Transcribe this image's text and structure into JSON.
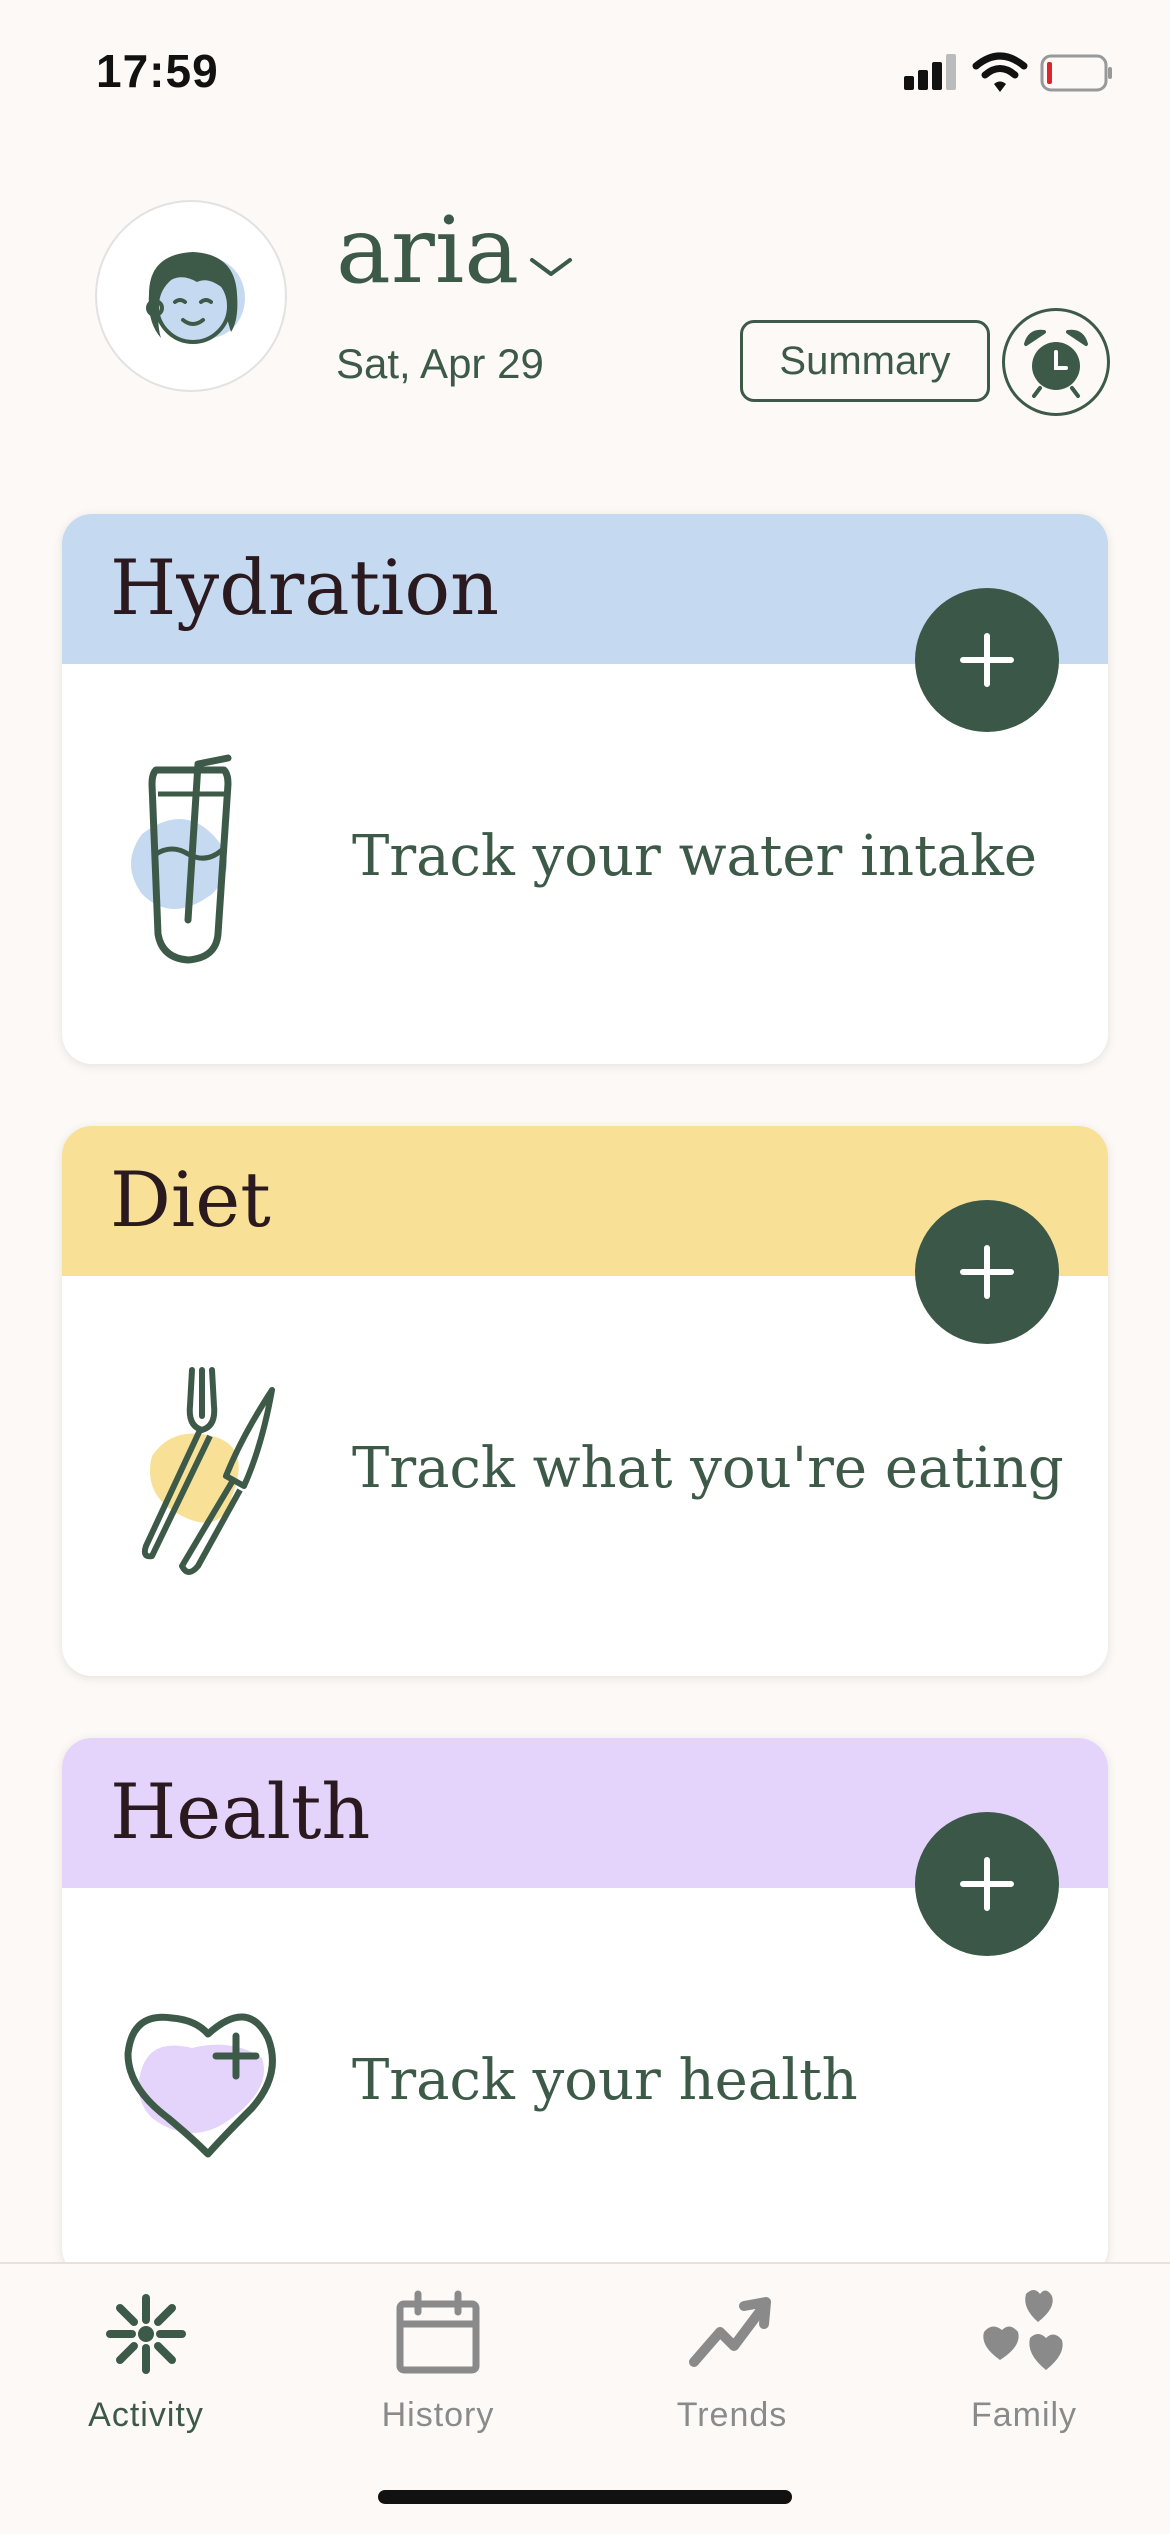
{
  "status_bar": {
    "time": "17:59",
    "icons": [
      "cellular-signal-icon",
      "wifi-icon",
      "battery-low-icon"
    ]
  },
  "header": {
    "name": "aria",
    "date": "Sat, Apr 29",
    "summary_label": "Summary",
    "icons": [
      "avatar-face-icon",
      "chevron-down-icon",
      "alarm-clock-icon"
    ]
  },
  "cards": [
    {
      "title": "Hydration",
      "text": "Track your water intake",
      "header_color": "#c5d9f0",
      "icon": "water-glass-icon"
    },
    {
      "title": "Diet",
      "text": "Track what you're eating",
      "header_color": "#f8e196",
      "icon": "fork-knife-icon"
    },
    {
      "title": "Health",
      "text": "Track your health",
      "header_color": "#e4d4fb",
      "icon": "heart-plus-icon"
    }
  ],
  "nav": {
    "items": [
      {
        "label": "Activity",
        "icon": "activity-sparkle-icon",
        "active": true
      },
      {
        "label": "History",
        "icon": "calendar-icon",
        "active": false
      },
      {
        "label": "Trends",
        "icon": "trend-arrow-icon",
        "active": false
      },
      {
        "label": "Family",
        "icon": "hearts-icon",
        "active": false
      }
    ]
  },
  "colors": {
    "accent_green": "#3b5748",
    "background": "#fdf9f6"
  }
}
